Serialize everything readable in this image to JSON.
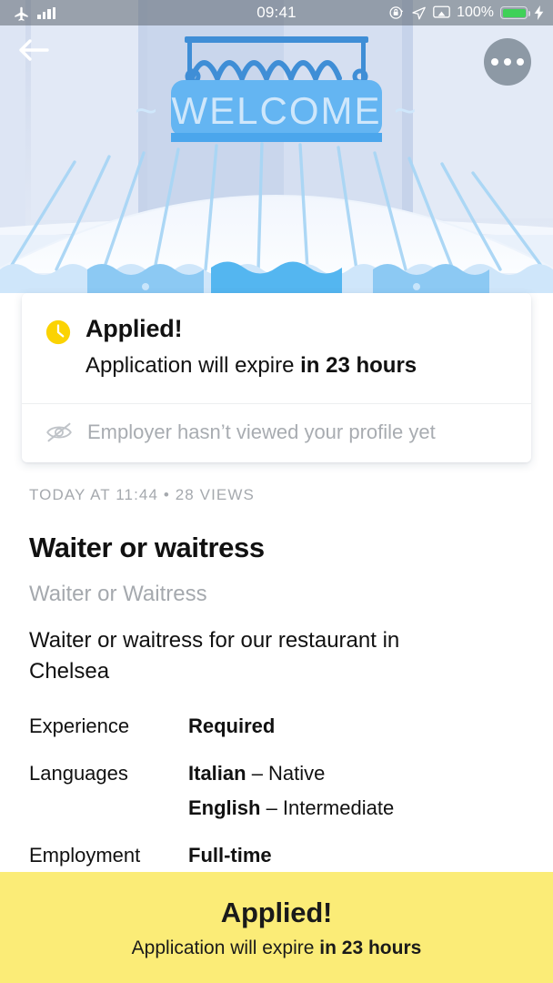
{
  "statusbar": {
    "airplane_icon": "airplane-mode-icon",
    "signal_icon": "signal-bars-icon",
    "time": "09:41",
    "rotation_lock_icon": "rotation-lock-icon",
    "location_icon": "location-arrow-icon",
    "airplay_icon": "screen-mirroring-icon",
    "battery_percent": "100%",
    "charging_icon": "charging-bolt-icon",
    "battery_color": "#3fd158"
  },
  "hero": {
    "back_icon": "back-arrow-icon",
    "more_icon": "more-options-icon",
    "sign_text": "WELCOME",
    "sign_ornament_left": "~",
    "sign_ornament_right": "~",
    "awning_color": "#6cc0f0",
    "sign_color": "#64b5f2"
  },
  "status_card": {
    "clock_icon": "clock-icon",
    "clock_color": "#fbd303",
    "title": "Applied!",
    "expire_prefix": "Application will expire ",
    "expire_value": "in 23 hours",
    "viewed_icon": "eye-slash-icon",
    "viewed_text": "Employer hasn’t viewed your profile yet"
  },
  "job": {
    "meta": "TODAY AT 11:44  •  28 VIEWS",
    "title": "Waiter or waitress",
    "subtitle": "Waiter or Waitress",
    "description": "Waiter or waitress for our restaurant in Chelsea",
    "details": [
      {
        "label": "Experience",
        "values": [
          {
            "strong": "Required",
            "rest": ""
          }
        ]
      },
      {
        "label": "Languages",
        "values": [
          {
            "strong": "Italian",
            "rest": " – Native"
          },
          {
            "strong": "English",
            "rest": " – Intermediate"
          }
        ]
      },
      {
        "label": "Employment",
        "values": [
          {
            "strong": "Full-time",
            "rest": ""
          }
        ]
      }
    ]
  },
  "banner": {
    "title": "Applied!",
    "sub_prefix": "Application will expire ",
    "sub_value": "in 23 hours",
    "background": "#fbec77"
  }
}
